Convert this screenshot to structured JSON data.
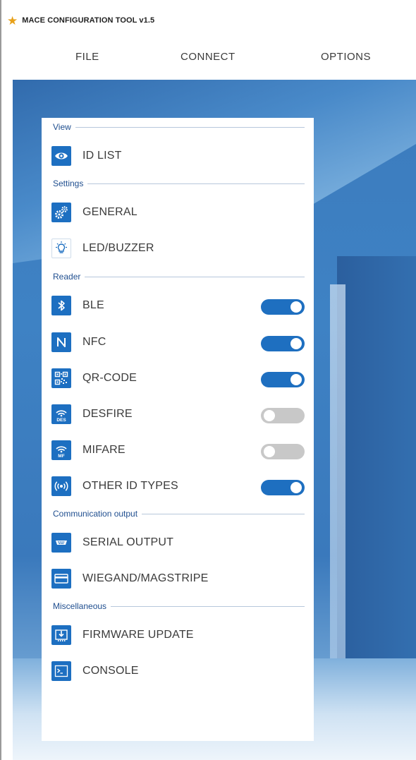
{
  "window": {
    "title": "MACE CONFIGURATION TOOL v1.5",
    "icon": "star-icon"
  },
  "menu": {
    "file": "FILE",
    "connect": "CONNECT",
    "options": "OPTIONS"
  },
  "sections": {
    "view": "View",
    "settings": "Settings",
    "reader": "Reader",
    "communication": "Communication output",
    "misc": "Miscellaneous"
  },
  "items": {
    "id_list": "ID LIST",
    "general": "GENERAL",
    "led_buzzer": "LED/BUZZER",
    "ble": "BLE",
    "nfc": "NFC",
    "qr_code": "QR-CODE",
    "desfire": "DESFIRE",
    "mifare": "MIFARE",
    "other_id_types": "OTHER ID TYPES",
    "serial_output": "SERIAL OUTPUT",
    "wiegand": "WIEGAND/MAGSTRIPE",
    "firmware_update": "FIRMWARE UPDATE",
    "console": "CONSOLE"
  },
  "toggles": {
    "ble": true,
    "nfc": true,
    "qr_code": true,
    "desfire": false,
    "mifare": false,
    "other_id_types": true
  },
  "colors": {
    "accent": "#1e6fc0",
    "toggle_off": "#c8c8c8",
    "section_label": "#1f4e8f"
  },
  "icons": {
    "id_list": "eye-icon",
    "general": "gears-icon",
    "led_buzzer": "bulb-icon",
    "ble": "bluetooth-icon",
    "nfc": "nfc-icon",
    "qr_code": "qr-code-icon",
    "desfire": "desfire-icon",
    "mifare": "mifare-icon",
    "other_id_types": "wireless-icon",
    "serial_output": "serial-port-icon",
    "wiegand": "card-icon",
    "firmware_update": "download-icon",
    "console": "terminal-icon"
  }
}
